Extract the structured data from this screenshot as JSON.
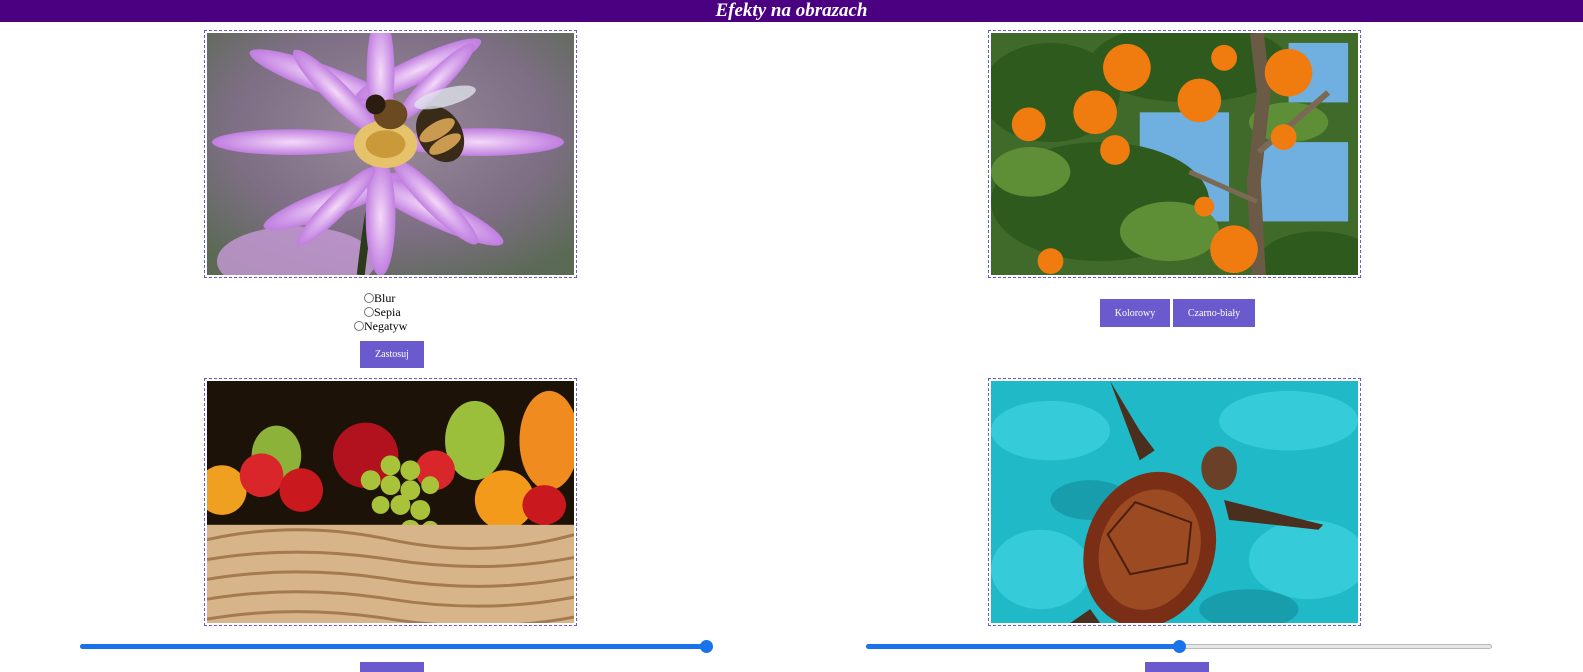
{
  "header": {
    "title": "Efekty na obrazach"
  },
  "panel1": {
    "image": "bee-on-purple-flower",
    "options": [
      "Blur",
      "Sepia",
      "Negatyw"
    ],
    "apply_label": "Zastosuj"
  },
  "panel2": {
    "image": "orange-tree",
    "color_label": "Kolorowy",
    "bw_label": "Czarno-biały"
  },
  "panel3": {
    "image": "fruit-basket",
    "slider_value": 1.0
  },
  "panel4": {
    "image": "sea-turtle",
    "slider_value": 0.5
  },
  "colors": {
    "header_bg": "#4b0082",
    "button_bg": "#6a5acd",
    "slider_fill": "#1a73e8"
  }
}
